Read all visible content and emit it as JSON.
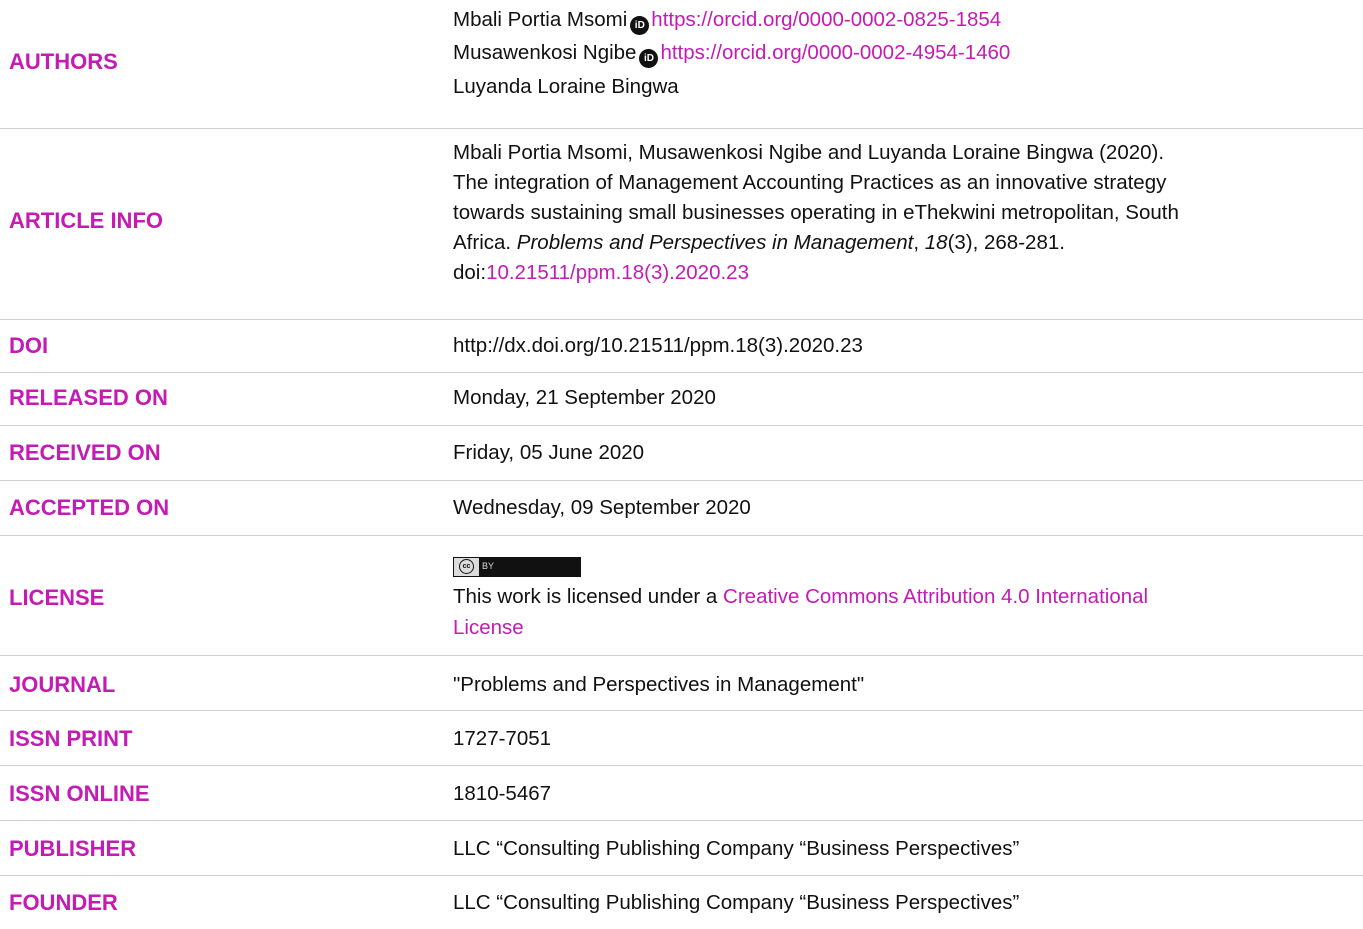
{
  "colors": {
    "label": "#c41bb5",
    "link": "#c41bb5",
    "text": "#111111",
    "divider": "#cfcfcf"
  },
  "authors": {
    "label": "AUTHORS",
    "list": [
      {
        "name": "Mbali Portia Msomi",
        "orcid_icon": "orcid-icon",
        "orcid": "https://orcid.org/0000-0002-0825-1854"
      },
      {
        "name": "Musawenkosi Ngibe",
        "orcid_icon": "orcid-icon",
        "orcid": "https://orcid.org/0000-0002-4954-1460"
      },
      {
        "name": "Luyanda Loraine Bingwa"
      }
    ]
  },
  "article_info": {
    "label": "ARTICLE INFO",
    "line1": "Mbali Portia Msomi, Musawenkosi Ngibe and Luyanda Loraine Bingwa (2020).",
    "line2": "The integration of Management Accounting Practices as an innovative strategy",
    "line3": "towards sustaining small businesses operating in eThekwini metropolitan, South",
    "line4_prefix": "Africa. ",
    "journal_italic": "Problems and Perspectives in Management",
    "comma1": ", ",
    "volume_italic": "18",
    "issue_pages": "(3), 268-281.",
    "doi_prefix": "doi:",
    "doi_link": "10.21511/ppm.18(3).2020.23"
  },
  "doi": {
    "label": "DOI",
    "value": "http://dx.doi.org/10.21511/ppm.18(3).2020.23"
  },
  "released_on": {
    "label": "RELEASED ON",
    "value": "Monday, 21 September 2020"
  },
  "received_on": {
    "label": "RECEIVED ON",
    "value": "Friday, 05 June 2020"
  },
  "accepted_on": {
    "label": "ACCEPTED ON",
    "value": "Wednesday, 09 September 2020"
  },
  "license": {
    "label": "LICENSE",
    "badge_cc": "cc",
    "badge_by": "BY",
    "text_prefix": "This work is licensed under a ",
    "link_part1": "Creative Commons Attribution 4.0 International",
    "link_part2": "License"
  },
  "journal": {
    "label": "JOURNAL",
    "value": "\"Problems and Perspectives in Management\""
  },
  "issn_print": {
    "label": "ISSN PRINT",
    "value": "1727-7051"
  },
  "issn_online": {
    "label": "ISSN ONLINE",
    "value": "1810-5467"
  },
  "publisher": {
    "label": "PUBLISHER",
    "value": "LLC “Consulting Publishing Company “Business Perspectives”"
  },
  "founder": {
    "label": "FOUNDER",
    "value": "LLC “Consulting Publishing Company “Business Perspectives”"
  }
}
